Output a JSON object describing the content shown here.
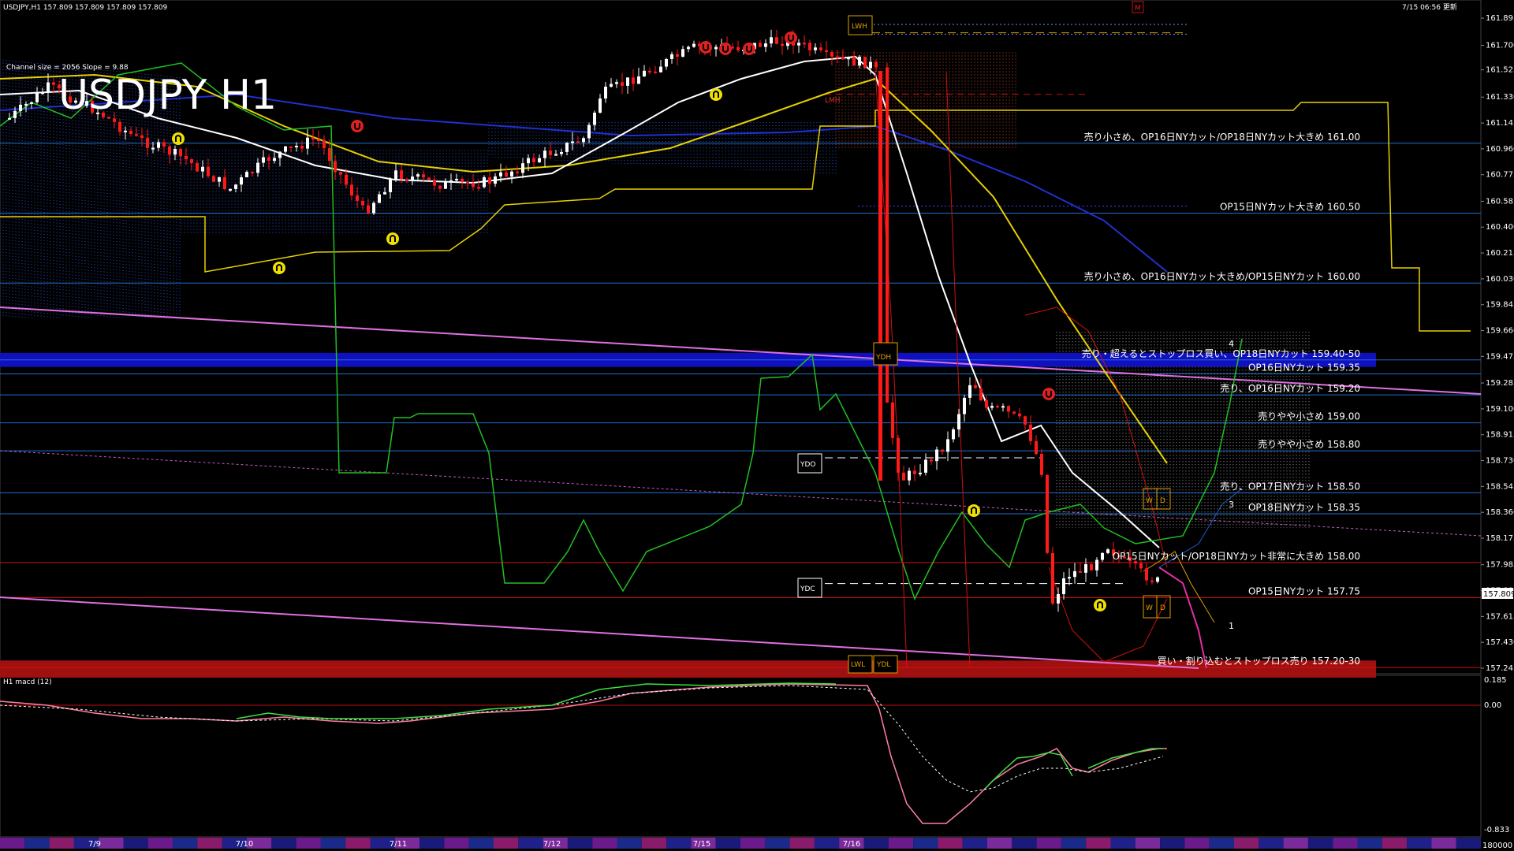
{
  "header": {
    "symbol_info": "USDJPY,H1  157.809 157.809 157.809 157.809",
    "timestamp": "7/15 06:56 更新",
    "big_title": "USDJPY H1",
    "channel_note": "Channel size = 2056 Slope = 9.88",
    "m_marker": "M"
  },
  "price_axis": {
    "ticks": [
      "161.895",
      "161.700",
      "161.525",
      "161.330",
      "161.145",
      "160.960",
      "160.775",
      "160.585",
      "160.400",
      "160.215",
      "160.030",
      "159.845",
      "159.660",
      "159.475",
      "159.285",
      "159.100",
      "158.915",
      "158.730",
      "158.545",
      "158.360",
      "158.175",
      "157.985",
      "157.800",
      "157.615",
      "157.430",
      "157.245"
    ],
    "current_price": "157.809"
  },
  "levels": [
    {
      "label": "売り小さめ、OP16日NYカット/OP18日NYカット大きめ 161.00",
      "price": 161.0,
      "color": "#1e6fd0"
    },
    {
      "label": "OP15日NYカット大きめ 160.50",
      "price": 160.5,
      "color": "#1e6fd0"
    },
    {
      "label": "売り小さめ、OP16日NYカット大きめ/OP15日NYカット 160.00",
      "price": 160.0,
      "color": "#1e6fd0"
    },
    {
      "label": "売り・超えるとストップロス買い、OP18日NYカット 159.40-50",
      "price": 159.45,
      "color": "#1e6fd0"
    },
    {
      "label": "OP16日NYカット 159.35",
      "price": 159.35,
      "color": "#1e6fd0"
    },
    {
      "label": "売り、OP16日NYカット 159.20",
      "price": 159.2,
      "color": "#1e6fd0"
    },
    {
      "label": "売りやや小さめ 159.00",
      "price": 159.0,
      "color": "#1e6fd0"
    },
    {
      "label": "売りやや小さめ 158.80",
      "price": 158.8,
      "color": "#1e6fd0"
    },
    {
      "label": "売り、OP17日NYカット 158.50",
      "price": 158.5,
      "color": "#1e6fd0"
    },
    {
      "label": "OP18日NYカット 158.35",
      "price": 158.35,
      "color": "#1e6fd0"
    },
    {
      "label": "OP15日NYカット/OP18日NYカット非常に大きめ 158.00",
      "price": 158.0,
      "color": "#d01010"
    },
    {
      "label": "OP15日NYカット 157.75",
      "price": 157.75,
      "color": "#d01010"
    },
    {
      "label": "買い・割り込むとストップロス売り 157.20-30",
      "price": 157.25,
      "color": "#d01010"
    }
  ],
  "markers": {
    "lwh": "LWH",
    "ydh": "YDH",
    "ydo": "YDO",
    "ydc": "YDC",
    "lwl": "LWL",
    "ydl": "YDL",
    "lmh": "LMH",
    "w1": "W",
    "d1": "D",
    "w2": "W",
    "d2": "D",
    "n1": "1",
    "n3": "3",
    "n4": "4"
  },
  "macd": {
    "title": "H1  macd (12)",
    "ticks": [
      "0.185",
      "0.00",
      "-0.833"
    ]
  },
  "time_axis": {
    "dates": [
      "7/9",
      "7/10",
      "7/11",
      "7/12",
      "7/15",
      "7/16"
    ],
    "bottom_right": "180000"
  },
  "colors": {
    "bg": "#000000",
    "up": "#ffffff",
    "down": "#ff1a1a",
    "ma_white": "#ffffff",
    "ma_yellow": "#e8d000",
    "ma_blue": "#2030d0",
    "ichimoku_green": "#20c020",
    "pink_line": "#e070e0",
    "blue_band": "#1010c0",
    "red_band": "#a01010"
  }
}
